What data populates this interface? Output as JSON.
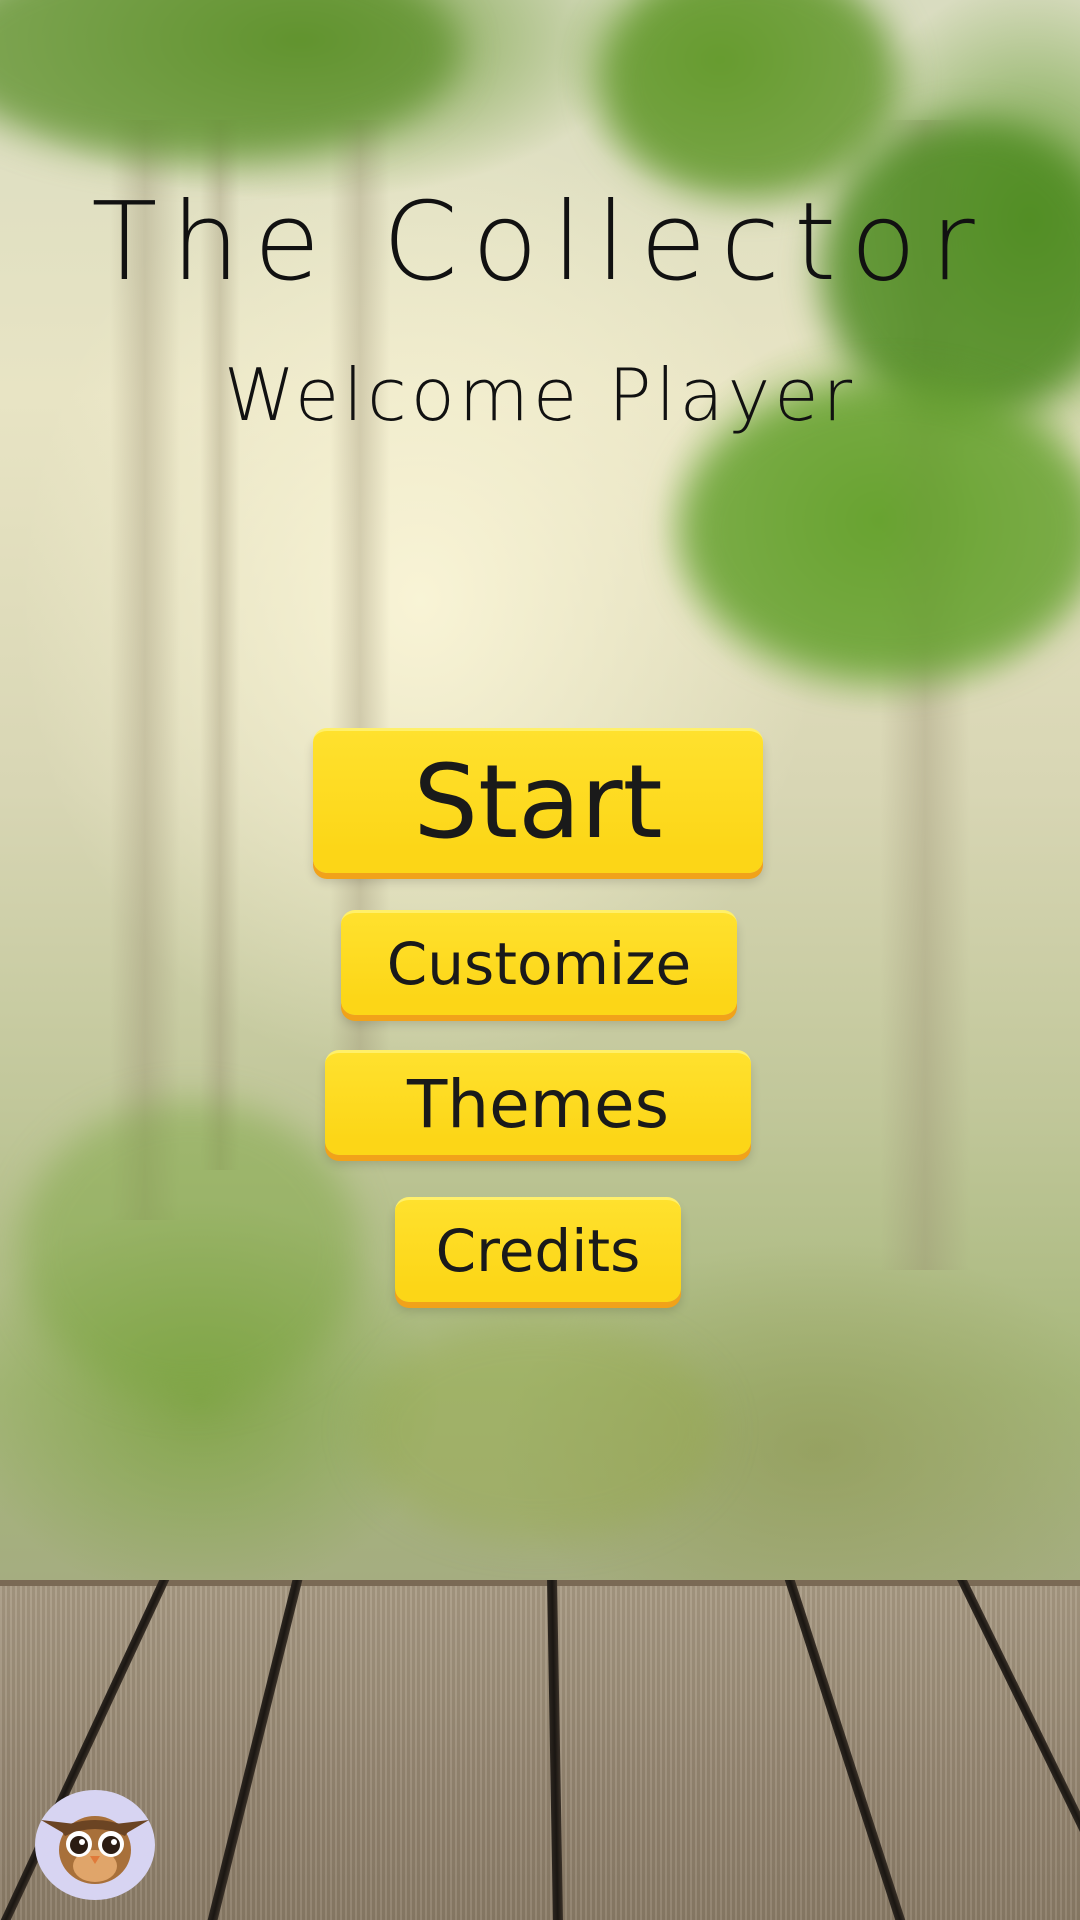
{
  "game": {
    "title": "The Collector",
    "subtitle": "Welcome Player"
  },
  "menu": {
    "start_label": "Start",
    "customize_label": "Customize",
    "themes_label": "Themes",
    "credits_label": "Credits"
  },
  "profile": {
    "avatar_icon": "owl-icon"
  },
  "colors": {
    "button_fill": "#fcd617",
    "button_shadow": "#f1a21a",
    "text": "#111111"
  }
}
